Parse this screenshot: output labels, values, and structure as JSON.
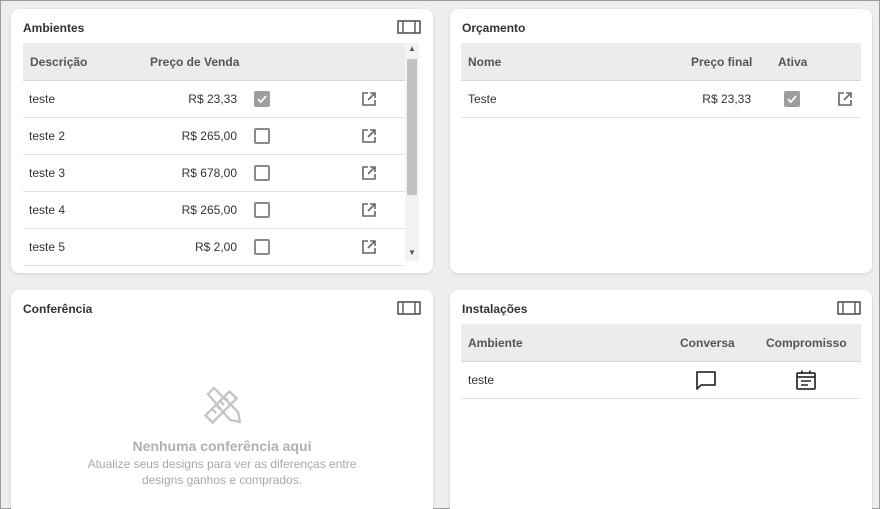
{
  "ambientes": {
    "title": "Ambientes",
    "columns": [
      "Descrição",
      "Preço de Venda"
    ],
    "rows": [
      {
        "descricao": "teste",
        "preco": "R$ 23,33",
        "checked": true
      },
      {
        "descricao": "teste 2",
        "preco": "R$ 265,00",
        "checked": false
      },
      {
        "descricao": "teste 3",
        "preco": "R$ 678,00",
        "checked": false
      },
      {
        "descricao": "teste 4",
        "preco": "R$ 265,00",
        "checked": false
      },
      {
        "descricao": "teste 5",
        "preco": "R$ 2,00",
        "checked": false
      }
    ]
  },
  "orcamento": {
    "title": "Orçamento",
    "columns": [
      "Nome",
      "Preço final",
      "Ativa"
    ],
    "rows": [
      {
        "nome": "Teste",
        "preco": "R$ 23,33",
        "ativa": true
      }
    ]
  },
  "conferencia": {
    "title": "Conferência",
    "empty_title": "Nenhuma conferência aqui",
    "empty_subtitle": "Atualize seus designs para ver as diferenças entre designs ganhos e comprados."
  },
  "instalacoes": {
    "title": "Instalações",
    "columns": [
      "Ambiente",
      "Conversa",
      "Compromisso"
    ],
    "rows": [
      {
        "ambiente": "teste"
      }
    ]
  },
  "icons": {
    "expand": "view-column-icon",
    "open": "open-in-new-icon",
    "conversa": "chat-bubble-icon",
    "compromisso": "calendar-icon",
    "empty": "ruler-pencil-icon"
  },
  "colors": {
    "background": "#eeeeee",
    "header_bg": "#ececec",
    "checked": "#9e9e9e"
  }
}
